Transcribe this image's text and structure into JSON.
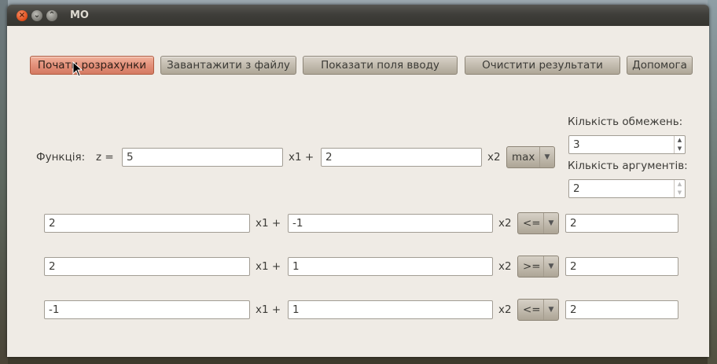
{
  "window": {
    "title": "MO"
  },
  "toolbar": {
    "start": "Почати розрахунки",
    "load": "Завантажити з файлу",
    "show_inputs": "Показати поля вводу",
    "clear": "Очистити результати",
    "help": "Допомога"
  },
  "settings": {
    "constraints_label": "Кількість обмежень:",
    "constraints_value": "3",
    "arguments_label": "Кількість аргументів:",
    "arguments_value": "2"
  },
  "function": {
    "label": "Функція:",
    "z_label": "z =",
    "c1": "5",
    "x1_label": "x1  +",
    "c2": "2",
    "x2_label": "x2",
    "goal": "max"
  },
  "constraints": [
    {
      "a1": "2",
      "x1_label": "x1  +",
      "a2": "-1",
      "x2_label": "x2",
      "sign": "<=",
      "b": "2"
    },
    {
      "a1": "2",
      "x1_label": "x1  +",
      "a2": "1",
      "x2_label": "x2",
      "sign": ">=",
      "b": "2"
    },
    {
      "a1": "-1",
      "x1_label": "x1  +",
      "a2": "1",
      "x2_label": "x2",
      "sign": "<=",
      "b": "2"
    }
  ]
}
